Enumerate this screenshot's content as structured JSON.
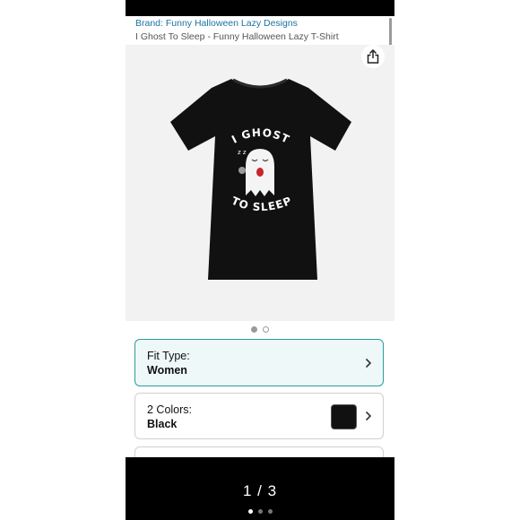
{
  "product": {
    "brand": "Brand: Funny Halloween Lazy Designs",
    "title": "I Ghost To Sleep - Funny Halloween Lazy T-Shirt"
  },
  "image": {
    "print_top": "I GHOST",
    "print_bottom": "TO SLEEP",
    "snore": "z z",
    "carousel_index": 1,
    "carousel_total": 2
  },
  "options": {
    "fit": {
      "label": "Fit Type:",
      "value": "Women"
    },
    "color": {
      "label": "2 Colors:",
      "value": "Black",
      "swatch": "#111111"
    }
  },
  "viewer": {
    "counter": "1 / 3",
    "dots_total": 3,
    "active_dot": 1
  },
  "colors": {
    "accent": "#2a9d9a",
    "link": "#1a73a0",
    "shirt": "#111111"
  }
}
